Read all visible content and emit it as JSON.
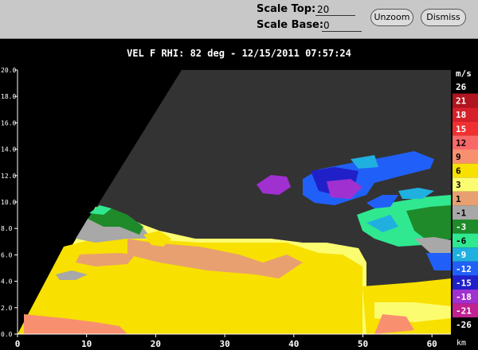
{
  "toolbar": {
    "scale_top_label": "Scale Top:",
    "scale_top_value": "20",
    "scale_base_label": "Scale Base:",
    "scale_base_value": "0",
    "unzoom_label": "Unzoom",
    "dismiss_label": "Dismiss"
  },
  "plot": {
    "title": "VEL F  RHI: 82 deg  -  12/15/2011 07:57:24",
    "y_ticks": [
      "20.0",
      "18.0",
      "16.0",
      "14.0",
      "12.0",
      "10.0",
      "8.0",
      "6.0",
      "4.0",
      "2.0",
      "0.0"
    ],
    "x_ticks": [
      "0",
      "10",
      "20",
      "30",
      "40",
      "50",
      "60"
    ],
    "x_unit": "km"
  },
  "colorbar": {
    "unit": "m/s",
    "entries": [
      {
        "label": "26",
        "color": "#000000"
      },
      {
        "label": "21",
        "color": "#b0141e"
      },
      {
        "label": "18",
        "color": "#d8202a"
      },
      {
        "label": "15",
        "color": "#f03030"
      },
      {
        "label": "12",
        "color": "#f86868"
      },
      {
        "label": "9",
        "color": "#f89070"
      },
      {
        "label": "6",
        "color": "#f8e000"
      },
      {
        "label": "3",
        "color": "#fcfc70"
      },
      {
        "label": "1",
        "color": "#e8a070"
      },
      {
        "label": "-1",
        "color": "#a8a8a8"
      },
      {
        "label": "-3",
        "color": "#1f8a2a"
      },
      {
        "label": "-6",
        "color": "#30e890"
      },
      {
        "label": "-9",
        "color": "#20b0e0"
      },
      {
        "label": "-12",
        "color": "#2060f8"
      },
      {
        "label": "-15",
        "color": "#2020c8"
      },
      {
        "label": "-18",
        "color": "#a030d0"
      },
      {
        "label": "-21",
        "color": "#c02090"
      },
      {
        "label": "-26",
        "color": "#000000"
      }
    ]
  }
}
